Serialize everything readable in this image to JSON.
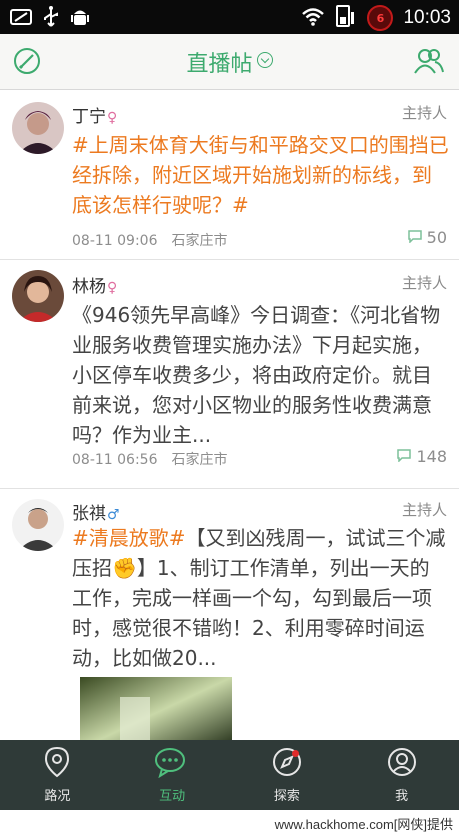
{
  "status_bar": {
    "time": "10:03",
    "battery_badge": "6",
    "icons": [
      "screenshot-icon",
      "usb-icon",
      "android-debug-icon",
      "wifi-icon",
      "signal-icon",
      "battery-icon"
    ]
  },
  "header": {
    "title": "直播帖",
    "left_icon": "compose-icon",
    "right_icon": "contacts-icon",
    "accent_color": "#3daa6e"
  },
  "posts": [
    {
      "name": "丁宁",
      "gender_symbol": "♀",
      "role": "主持人",
      "content_highlight": "#上周末体育大街与和平路交叉口的围挡已经拆除，附近区域开始施划新的标线，到底该怎样行驶呢？#",
      "content_rest": "",
      "time": "08-11 09:06",
      "city": "石家庄市",
      "comment_count": "50"
    },
    {
      "name": "林杨",
      "gender_symbol": "♀",
      "role": "主持人",
      "content_highlight": "",
      "content_rest": "《946领先早高峰》今日调查：《河北省物业服务收费管理实施办法》下月起实施，小区停车收费多少，将由政府定价。就目前来说，您对小区物业的服务性收费满意吗？作为业主...",
      "time": "08-11 06:56",
      "city": "石家庄市",
      "comment_count": "148"
    },
    {
      "name": "张祺",
      "gender_symbol": "♂",
      "role": "主持人",
      "content_highlight": "#清晨放歌#",
      "content_rest": "【又到凶残周一，试试三个减压招✊】1、制订工作清单，列出一天的工作，完成一样画一个勾，勾到最后一项时，感觉很不错哟！2、利用零碎时间运动，比如做20..."
    }
  ],
  "bottom_nav": [
    {
      "label": "路况",
      "icon": "location-pin-icon",
      "active": false
    },
    {
      "label": "互动",
      "icon": "chat-bubbles-icon",
      "active": true
    },
    {
      "label": "探索",
      "icon": "compass-icon",
      "active": false,
      "badge_dot": true
    },
    {
      "label": "我",
      "icon": "profile-icon",
      "active": false
    }
  ],
  "watermark": "www.hackhome.com[网侠]提供"
}
